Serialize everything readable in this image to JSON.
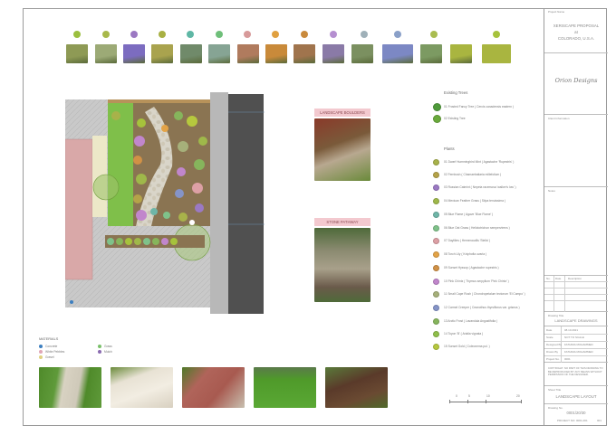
{
  "title_block": {
    "project_name_label": "Project Name",
    "project_lines": [
      "XERISCAPE PROPOSAL",
      "at",
      "COLORADO, U.S.A."
    ],
    "logo_text": "Orion Designs",
    "client_label": "Client Information",
    "notes_label": "Notes",
    "revisions_headers": [
      "No.",
      "Date",
      "Description"
    ],
    "drawing_title_label": "Drawing Title",
    "drawing_title": "LANDSCAPE DRAWINGS",
    "info_rows": [
      {
        "label": "Date",
        "value": "08.10.2021"
      },
      {
        "label": "Scale",
        "value": "NOT TO SCALE"
      },
      {
        "label": "Designed By",
        "value": "FATHIMA MOHAMMED"
      },
      {
        "label": "Drawn By",
        "value": "FATHIMA MOHAMMED"
      },
      {
        "label": "Project No.",
        "value": "0001"
      }
    ],
    "copyright": "COPYRIGHT. NO PART OF THIS DRAWING TO BE REPRODUCED BY ANY MEANS WITHOUT PERMISSION OF THE DESIGNER.",
    "sheet_title_label": "Sheet Title",
    "sheet_title": "LANDSCAPE LAYOUT",
    "sheet_no_label": "Drawing No.",
    "sheet_no": "0001/20/30",
    "sheet_footer": "PROJECT NO: 0001-001",
    "sheet_page": "001"
  },
  "plant_strip_colors": {
    "dots": [
      "#9bbf3f",
      "#a8b84a",
      "#9b78c2",
      "#a8b043",
      "#5fb7a5",
      "#6fbf7a",
      "#d79a9a",
      "#e0a040",
      "#c98a3c",
      "#b58fd0",
      "#9fb0b8",
      "#8aa0c8",
      "#a9bc50",
      "#a6c23c"
    ],
    "thumbs": [
      "#8e9a55",
      "#9caa76",
      "#7c6cc0",
      "#a9a34e",
      "#708a6a",
      "#86a494",
      "#b07b5e",
      "#c98a3a",
      "#a0744d",
      "#8a7aa7",
      "#7b9060",
      "#7c88c4",
      "#7c9a62",
      "#a9b540"
    ]
  },
  "callouts": {
    "boulders": "LANDSCAPE BOULDERS",
    "pathway": "STONE PATHWAY"
  },
  "legend": {
    "existing_trees_title": "Existing Trees",
    "existing_trees": [
      {
        "label": "01  Frosted Fancy Tree ( Cercis canadensis eastern )",
        "color": "#4f9a3a"
      },
      {
        "label": "02  Existing Tree",
        "color": "#6aaa3c"
      }
    ],
    "plants_title": "Plants",
    "plants": [
      {
        "label": "01  Dwarf Hummingbird Mint ( Agastache 'Rupestris' )",
        "color": "#a8b24a"
      },
      {
        "label": "02  Fernbush ( Chamaebatiaria millefolium )",
        "color": "#b5a349"
      },
      {
        "label": "03  Russian Catmint ( Nepeta racemosa 'walker's low' )",
        "color": "#9b79c4"
      },
      {
        "label": "04  Mexican Feather Grass ( Stipa tenuissima )",
        "color": "#9fb84a"
      },
      {
        "label": "05  Blue Flame ( Agave 'Blue Flame' )",
        "color": "#6fb6a8"
      },
      {
        "label": "06  Blue Oat Grass ( Helictotrichon sempervirens )",
        "color": "#7fc28a"
      },
      {
        "label": "07  Daylilies ( Hemerocallis 'Stella' )",
        "color": "#dda0a5"
      },
      {
        "label": "08  Torch Lily ( Kniphofia uvaria )",
        "color": "#e3a347"
      },
      {
        "label": "09  Sunset Hyssop ( Agastache rupestris )",
        "color": "#d19146"
      },
      {
        "label": "10  Pink Chintz ( Thymus serpyllum 'Pink Chintz' )",
        "color": "#c186cc"
      },
      {
        "label": "11  Small Cape Rush ( Chondropetalum tectorum 'El Campo' )",
        "color": "#a6b07a"
      },
      {
        "label": "12  Carmel Creeper ( Ceanothus thyrsiflorus var. griseus )",
        "color": "#8594c8"
      },
      {
        "label": "13  Arctic Frost ( Lavandula Angustifolia )",
        "color": "#86b55c"
      },
      {
        "label": "14  Toyon 'B' ( Arialia vignata )",
        "color": "#8fbf4a"
      },
      {
        "label": "15  Sunset Gold ( Coleonema pul. )",
        "color": "#b6c83e"
      }
    ]
  },
  "materials": {
    "title": "MATERIALS",
    "items": [
      {
        "label": "Concrete",
        "color": "#3d7fc0"
      },
      {
        "label": "Grass",
        "color": "#7ac06a"
      },
      {
        "label": "White Pebbles",
        "color": "#e0a6b6"
      },
      {
        "label": "Mulch",
        "color": "#8a6bb0"
      },
      {
        "label": "Gravel",
        "color": "#e0d080"
      }
    ]
  },
  "scale_bar": {
    "labels": [
      "0",
      "5",
      "10",
      "20"
    ]
  }
}
